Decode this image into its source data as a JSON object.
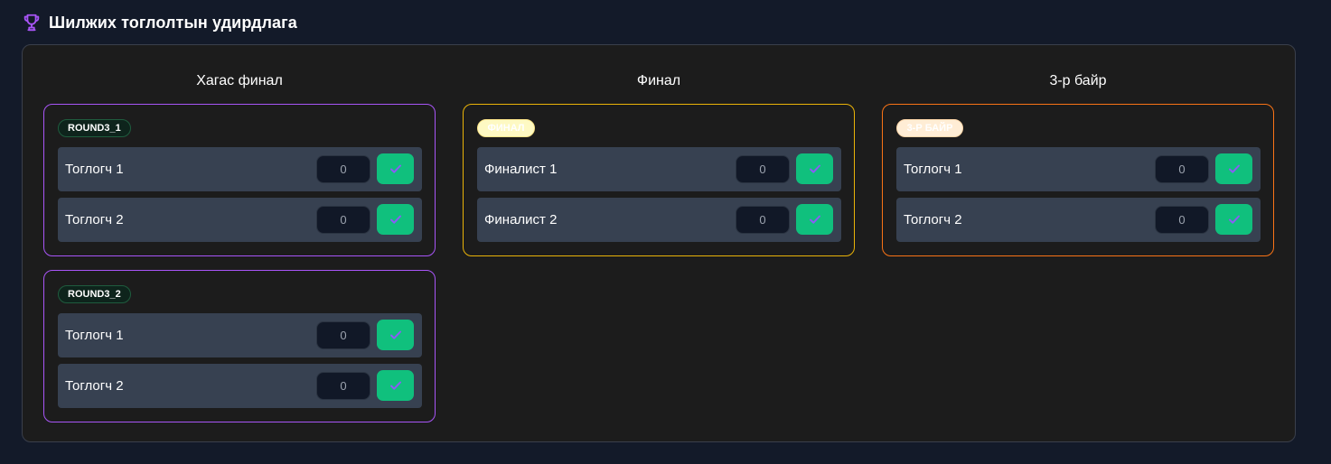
{
  "header": {
    "title": "Шилжих тоглолтын удирдлага",
    "icon": "trophy-icon",
    "icon_color": "#a855f7"
  },
  "columns": [
    {
      "title": "Хагас финал",
      "matches": [
        {
          "badge": "ROUND3_1",
          "players": [
            {
              "name": "Тоглогч 1",
              "score": "0"
            },
            {
              "name": "Тоглогч 2",
              "score": "0"
            }
          ]
        },
        {
          "badge": "ROUND3_2",
          "players": [
            {
              "name": "Тоглогч 1",
              "score": "0"
            },
            {
              "name": "Тоглогч 2",
              "score": "0"
            }
          ]
        }
      ]
    },
    {
      "title": "Финал",
      "matches": [
        {
          "badge": "ФИНАЛ",
          "players": [
            {
              "name": "Финалист 1",
              "score": "0"
            },
            {
              "name": "Финалист 2",
              "score": "0"
            }
          ]
        }
      ]
    },
    {
      "title": "3-р байр",
      "matches": [
        {
          "badge": "3-Р БАЙР",
          "players": [
            {
              "name": "Тоглогч 1",
              "score": "0"
            },
            {
              "name": "Тоглогч 2",
              "score": "0"
            }
          ]
        }
      ]
    }
  ],
  "colors": {
    "semifinal_border": "#a855f7",
    "final_border": "#eab308",
    "third_border": "#f97316",
    "confirm_button": "#10c07d",
    "check_icon": "#8b5cf6"
  },
  "icons": {
    "confirm": "check-icon"
  }
}
